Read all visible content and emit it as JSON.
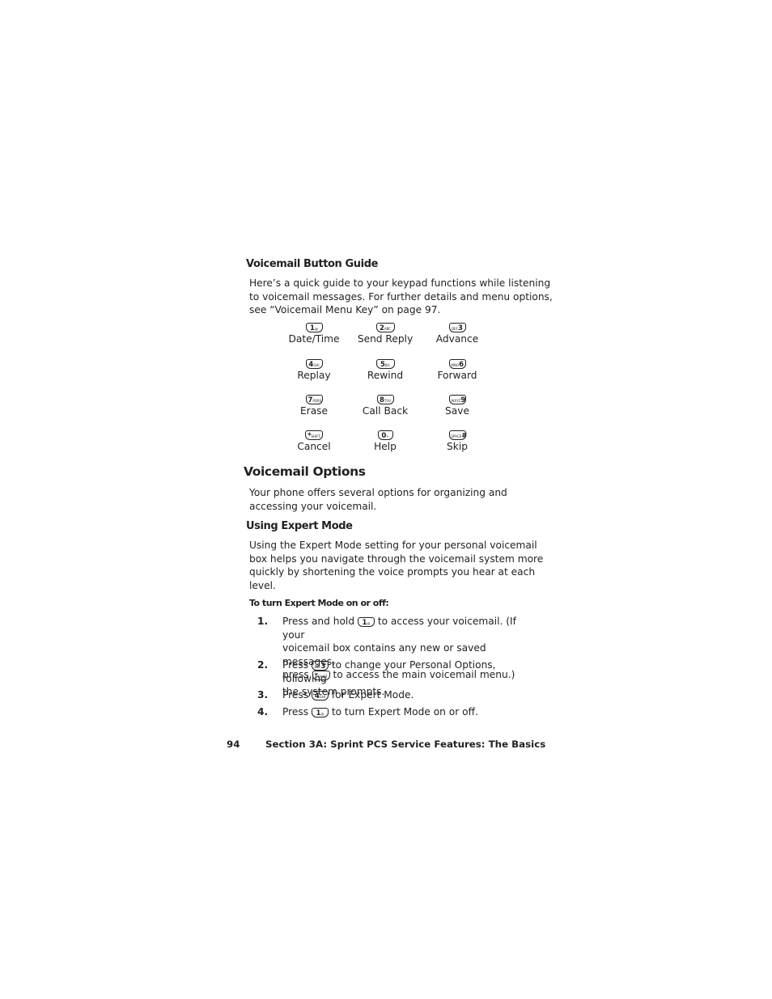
{
  "button_guide": {
    "heading": "Voicemail Button Guide",
    "intro": "Here’s a quick guide to your keypad functions while listening to voicemail messages. For further details and menu options, see “Voicemail Menu Key” on page 97.",
    "intro_lines": [
      "Here’s a quick guide to your keypad functions while listening",
      "to voicemail messages. For further details and menu options,",
      "see “Voicemail Menu Key” on page 97."
    ],
    "keys": [
      {
        "icon": "key-1-icon",
        "key_num": "1",
        "key_sub": "@",
        "label": "Date/Time"
      },
      {
        "icon": "key-2-icon",
        "key_num": "2",
        "key_sub": "ABC",
        "label": "Send Reply"
      },
      {
        "icon": "key-3-icon",
        "key_num": "3",
        "key_sub": "DEF",
        "label": "Advance"
      },
      {
        "icon": "key-4-icon",
        "key_num": "4",
        "key_sub": "GHI",
        "label": "Replay"
      },
      {
        "icon": "key-5-icon",
        "key_num": "5",
        "key_sub": "JKL",
        "label": "Rewind"
      },
      {
        "icon": "key-6-icon",
        "key_num": "6",
        "key_sub": "MNO",
        "label": "Forward"
      },
      {
        "icon": "key-7-icon",
        "key_num": "7",
        "key_sub": "PQRS",
        "label": "Erase"
      },
      {
        "icon": "key-8-icon",
        "key_num": "8",
        "key_sub": "TUV",
        "label": "Call Back"
      },
      {
        "icon": "key-9-icon",
        "key_num": "9",
        "key_sub": "WXYZ",
        "label": "Save"
      },
      {
        "icon": "key-star-icon",
        "key_num": "*",
        "key_sub": "SHIFT",
        "label": "Cancel"
      },
      {
        "icon": "key-0-icon",
        "key_num": "0",
        "key_sub": "+",
        "label": "Help"
      },
      {
        "icon": "key-pound-icon",
        "key_num": "#",
        "key_sub": "SPACE",
        "label": "Skip"
      }
    ]
  },
  "voicemail_options": {
    "heading": "Voicemail Options",
    "intro_lines": [
      "Your phone offers several options for organizing and",
      "accessing your voicemail."
    ]
  },
  "expert_mode": {
    "heading": "Using Expert Mode",
    "intro_lines": [
      "Using the Expert Mode setting for your personal voicemail",
      "box helps you navigate through the voicemail system more",
      "quickly by shortening the voice prompts you hear at each",
      "level."
    ],
    "procedure_heading": "To turn Expert Mode on or off:",
    "steps": [
      {
        "number": "1.",
        "parts": [
          "Press and hold",
          "to access your voicemail. (If your",
          "voicemail box contains any new or saved messages,",
          "press",
          "to access the main voicemail menu.)"
        ],
        "keys": [
          {
            "num": "1",
            "sub": "@"
          },
          {
            "num": "*",
            "sub": "SHIFT"
          }
        ]
      },
      {
        "number": "2.",
        "parts": [
          "Press",
          "to change your Personal Options, following",
          "the system prompts."
        ],
        "keys": [
          {
            "num": "3",
            "sub": "DEF"
          }
        ]
      },
      {
        "number": "3.",
        "parts": [
          "Press",
          "for Expert Mode."
        ],
        "keys": [
          {
            "num": "4",
            "sub": "GHI"
          }
        ]
      },
      {
        "number": "4.",
        "parts": [
          "Press",
          "to turn Expert Mode on or off."
        ],
        "keys": [
          {
            "num": "1",
            "sub": "@"
          }
        ]
      }
    ]
  },
  "footer": {
    "page_number": "94",
    "section_title": "Section 3A: Sprint PCS Service Features: The Basics"
  }
}
